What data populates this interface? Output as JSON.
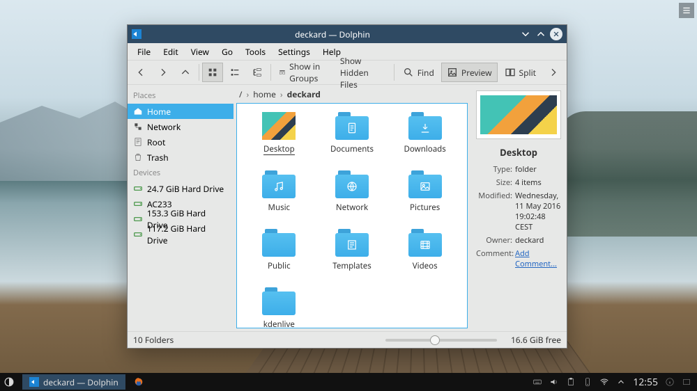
{
  "desktop": {
    "menu_button": "menu"
  },
  "window": {
    "title": "deckard — Dolphin",
    "menubar": [
      "File",
      "Edit",
      "View",
      "Go",
      "Tools",
      "Settings",
      "Help"
    ],
    "toolbar": {
      "back": "Back",
      "forward": "Forward",
      "up": "Up",
      "view_icons": "Icons",
      "view_compact": "Compact",
      "view_details": "Details",
      "show_groups": "Show in Groups",
      "show_hidden": "Show Hidden Files",
      "find": "Find",
      "preview": "Preview",
      "split": "Split",
      "overflow": "More"
    },
    "breadcrumb": {
      "root": "/",
      "home": "home",
      "current": "deckard"
    },
    "places_header": "Places",
    "places": [
      {
        "icon": "home",
        "label": "Home",
        "selected": true
      },
      {
        "icon": "network",
        "label": "Network"
      },
      {
        "icon": "root",
        "label": "Root"
      },
      {
        "icon": "trash",
        "label": "Trash"
      }
    ],
    "devices_header": "Devices",
    "devices": [
      {
        "icon": "drive",
        "label": "24.7 GiB Hard Drive"
      },
      {
        "icon": "drive",
        "label": "AC233"
      },
      {
        "icon": "drive",
        "label": "153.3 GiB Hard Drive"
      },
      {
        "icon": "drive",
        "label": "117.2 GiB Hard Drive"
      }
    ],
    "folders": [
      {
        "name": "Desktop",
        "kind": "desktop",
        "selected": true
      },
      {
        "name": "Documents",
        "kind": "documents"
      },
      {
        "name": "Downloads",
        "kind": "downloads"
      },
      {
        "name": "Music",
        "kind": "music"
      },
      {
        "name": "Network",
        "kind": "network"
      },
      {
        "name": "Pictures",
        "kind": "pictures"
      },
      {
        "name": "Public",
        "kind": "public"
      },
      {
        "name": "Templates",
        "kind": "templates"
      },
      {
        "name": "Videos",
        "kind": "videos"
      },
      {
        "name": "kdenlive",
        "kind": "plain"
      }
    ],
    "info": {
      "title": "Desktop",
      "type_label": "Type:",
      "type_value": "folder",
      "size_label": "Size:",
      "size_value": "4 items",
      "modified_label": "Modified:",
      "modified_value": "Wednesday, 11 May 2016 19:02:48 CEST",
      "owner_label": "Owner:",
      "owner_value": "deckard",
      "comment_label": "Comment:",
      "comment_link": "Add Comment..."
    },
    "status": {
      "count": "10 Folders",
      "free": "16.6 GiB free"
    }
  },
  "panel": {
    "task_title": "deckard — Dolphin",
    "clock": "12:55"
  }
}
